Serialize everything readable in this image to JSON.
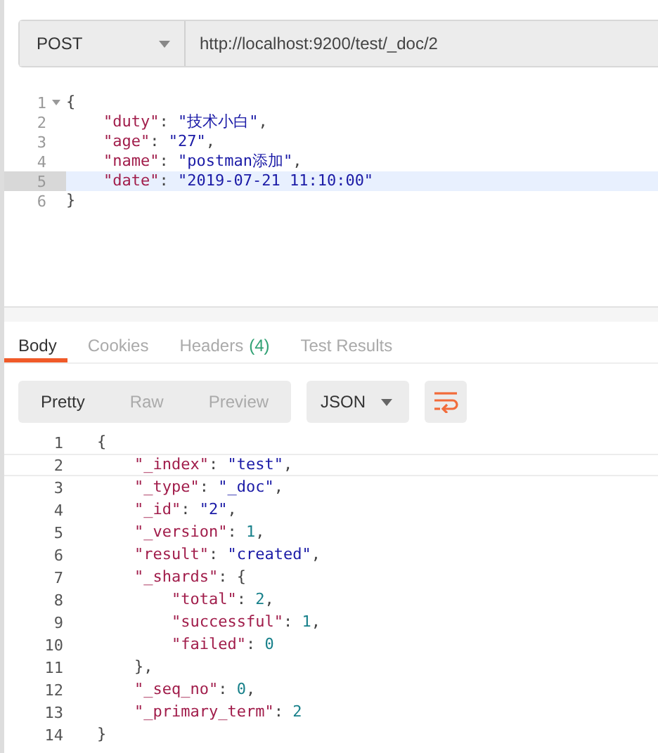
{
  "request": {
    "method": "POST",
    "url": "http://localhost:9200/test/_doc/2"
  },
  "request_body": {
    "lines": [
      {
        "number": "1",
        "foldable": true,
        "active": false,
        "tokens": [
          {
            "kind": "punct",
            "text": "{"
          }
        ]
      },
      {
        "number": "2",
        "foldable": false,
        "active": false,
        "tokens": [
          {
            "kind": "key",
            "text": "    \"duty\""
          },
          {
            "kind": "punct",
            "text": ": "
          },
          {
            "kind": "str",
            "text": "\"技术小白\""
          },
          {
            "kind": "punct",
            "text": ","
          }
        ]
      },
      {
        "number": "3",
        "foldable": false,
        "active": false,
        "tokens": [
          {
            "kind": "key",
            "text": "    \"age\""
          },
          {
            "kind": "punct",
            "text": ": "
          },
          {
            "kind": "str",
            "text": "\"27\""
          },
          {
            "kind": "punct",
            "text": ","
          }
        ]
      },
      {
        "number": "4",
        "foldable": false,
        "active": false,
        "tokens": [
          {
            "kind": "key",
            "text": "    \"name\""
          },
          {
            "kind": "punct",
            "text": ": "
          },
          {
            "kind": "str",
            "text": "\"postman添加\""
          },
          {
            "kind": "punct",
            "text": ","
          }
        ]
      },
      {
        "number": "5",
        "foldable": false,
        "active": true,
        "tokens": [
          {
            "kind": "key",
            "text": "    \"date\""
          },
          {
            "kind": "punct",
            "text": ": "
          },
          {
            "kind": "str",
            "text": "\"2019-07-21 11:10:00\""
          }
        ]
      },
      {
        "number": "6",
        "foldable": false,
        "active": false,
        "tokens": [
          {
            "kind": "punct",
            "text": "}"
          }
        ]
      }
    ]
  },
  "response_tabs": [
    {
      "label": "Body",
      "selected": true
    },
    {
      "label": "Cookies",
      "selected": false
    },
    {
      "label": "Headers",
      "count": "(4)",
      "selected": false
    },
    {
      "label": "Test Results",
      "selected": false
    }
  ],
  "view_modes": [
    {
      "label": "Pretty",
      "selected": true
    },
    {
      "label": "Raw",
      "selected": false
    },
    {
      "label": "Preview",
      "selected": false
    }
  ],
  "format": "JSON",
  "response_body": {
    "lines": [
      {
        "number": "1",
        "active": false,
        "tokens": [
          {
            "kind": "punct",
            "text": "{"
          }
        ]
      },
      {
        "number": "2",
        "active": true,
        "tokens": [
          {
            "kind": "key",
            "text": "    \"_index\""
          },
          {
            "kind": "punct",
            "text": ": "
          },
          {
            "kind": "str",
            "text": "\"test\""
          },
          {
            "kind": "punct",
            "text": ","
          }
        ]
      },
      {
        "number": "3",
        "active": false,
        "tokens": [
          {
            "kind": "key",
            "text": "    \"_type\""
          },
          {
            "kind": "punct",
            "text": ": "
          },
          {
            "kind": "str",
            "text": "\"_doc\""
          },
          {
            "kind": "punct",
            "text": ","
          }
        ]
      },
      {
        "number": "4",
        "active": false,
        "tokens": [
          {
            "kind": "key",
            "text": "    \"_id\""
          },
          {
            "kind": "punct",
            "text": ": "
          },
          {
            "kind": "str",
            "text": "\"2\""
          },
          {
            "kind": "punct",
            "text": ","
          }
        ]
      },
      {
        "number": "5",
        "active": false,
        "tokens": [
          {
            "kind": "key",
            "text": "    \"_version\""
          },
          {
            "kind": "punct",
            "text": ": "
          },
          {
            "kind": "num",
            "text": "1"
          },
          {
            "kind": "punct",
            "text": ","
          }
        ]
      },
      {
        "number": "6",
        "active": false,
        "tokens": [
          {
            "kind": "key",
            "text": "    \"result\""
          },
          {
            "kind": "punct",
            "text": ": "
          },
          {
            "kind": "str",
            "text": "\"created\""
          },
          {
            "kind": "punct",
            "text": ","
          }
        ]
      },
      {
        "number": "7",
        "active": false,
        "tokens": [
          {
            "kind": "key",
            "text": "    \"_shards\""
          },
          {
            "kind": "punct",
            "text": ": {"
          }
        ]
      },
      {
        "number": "8",
        "active": false,
        "tokens": [
          {
            "kind": "key",
            "text": "        \"total\""
          },
          {
            "kind": "punct",
            "text": ": "
          },
          {
            "kind": "num",
            "text": "2"
          },
          {
            "kind": "punct",
            "text": ","
          }
        ]
      },
      {
        "number": "9",
        "active": false,
        "tokens": [
          {
            "kind": "key",
            "text": "        \"successful\""
          },
          {
            "kind": "punct",
            "text": ": "
          },
          {
            "kind": "num",
            "text": "1"
          },
          {
            "kind": "punct",
            "text": ","
          }
        ]
      },
      {
        "number": "10",
        "active": false,
        "tokens": [
          {
            "kind": "key",
            "text": "        \"failed\""
          },
          {
            "kind": "punct",
            "text": ": "
          },
          {
            "kind": "num",
            "text": "0"
          }
        ]
      },
      {
        "number": "11",
        "active": false,
        "tokens": [
          {
            "kind": "punct",
            "text": "    },"
          }
        ]
      },
      {
        "number": "12",
        "active": false,
        "tokens": [
          {
            "kind": "key",
            "text": "    \"_seq_no\""
          },
          {
            "kind": "punct",
            "text": ": "
          },
          {
            "kind": "num",
            "text": "0"
          },
          {
            "kind": "punct",
            "text": ","
          }
        ]
      },
      {
        "number": "13",
        "active": false,
        "tokens": [
          {
            "kind": "key",
            "text": "    \"_primary_term\""
          },
          {
            "kind": "punct",
            "text": ": "
          },
          {
            "kind": "num",
            "text": "2"
          }
        ]
      },
      {
        "number": "14",
        "active": false,
        "tokens": [
          {
            "kind": "punct",
            "text": "}"
          }
        ]
      }
    ]
  }
}
